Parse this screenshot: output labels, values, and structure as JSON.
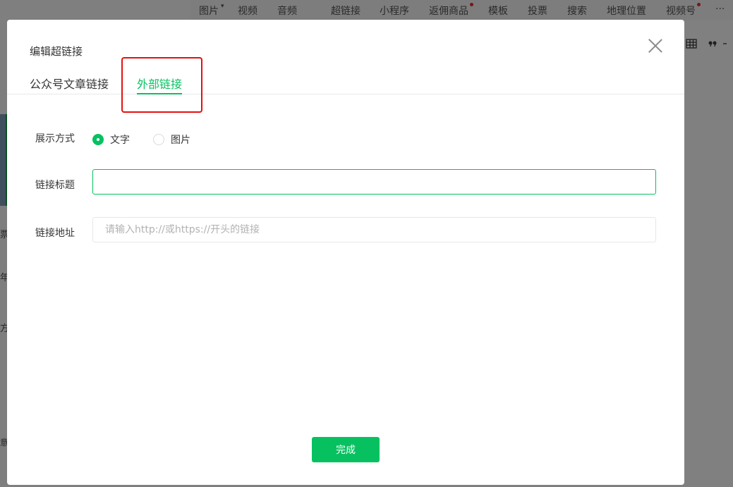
{
  "background": {
    "toolbar": {
      "items": [
        "图片",
        "视频",
        "音频",
        "超链接",
        "小程序",
        "返佣商品",
        "模板",
        "投票",
        "搜索",
        "地理位置",
        "视频号"
      ],
      "more": "···",
      "dropdown_arrow": "▾"
    },
    "right_icons": [
      "table-icon",
      "quote-icon"
    ],
    "left_chars": [
      "票",
      "年",
      "方",
      "意"
    ]
  },
  "modal": {
    "title": "编辑超链接",
    "tabs": [
      {
        "label": "公众号文章链接",
        "active": false
      },
      {
        "label": "外部链接",
        "active": true
      }
    ],
    "display_mode": {
      "label": "展示方式",
      "options": [
        {
          "label": "文字",
          "checked": true
        },
        {
          "label": "图片",
          "checked": false
        }
      ]
    },
    "link_title": {
      "label": "链接标题",
      "value": "",
      "placeholder": ""
    },
    "link_url": {
      "label": "链接地址",
      "value": "",
      "placeholder": "请输入http://或https://开头的链接"
    },
    "done_label": "完成"
  },
  "colors": {
    "accent": "#07c160",
    "highlight": "#e60f0f"
  }
}
